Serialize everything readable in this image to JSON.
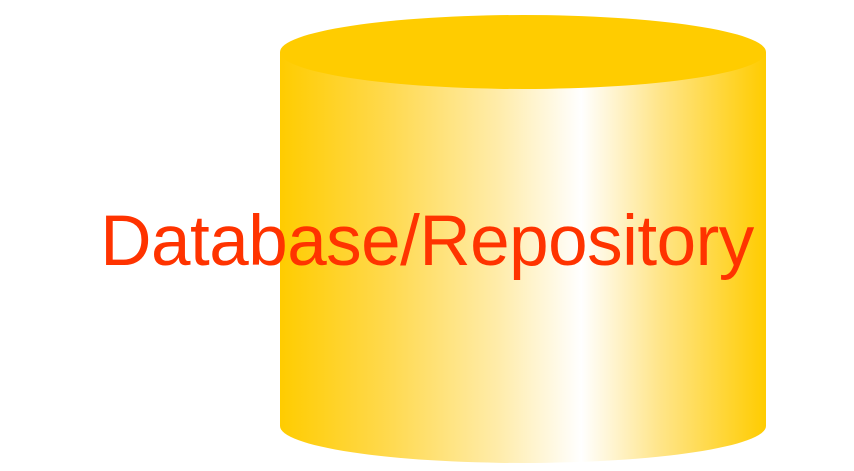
{
  "diagram": {
    "label": "Database/Repository",
    "shape": "cylinder-icon",
    "colors": {
      "label": "#ff3300",
      "cylinder_edge": "#ffcc00",
      "cylinder_highlight": "#ffffff",
      "cylinder_top": "#ffcc00"
    }
  }
}
